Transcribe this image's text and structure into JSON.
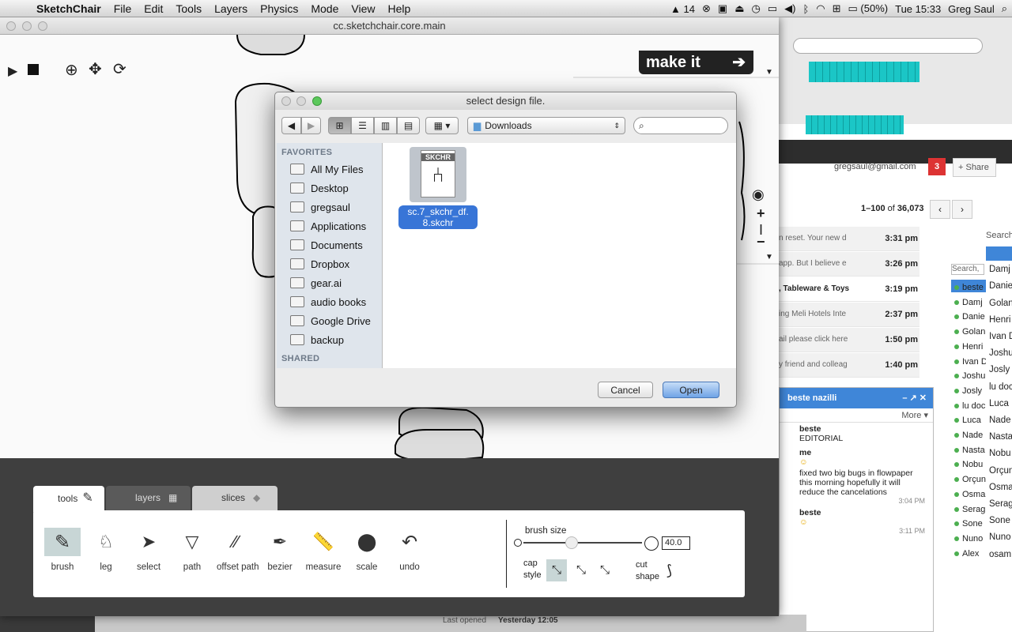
{
  "menubar": {
    "app_name": "SketchChair",
    "items": [
      "File",
      "Edit",
      "Tools",
      "Layers",
      "Physics",
      "Mode",
      "View",
      "Help"
    ],
    "status": {
      "notifications": "14",
      "battery": "(50%)",
      "clock": "Tue 15:33",
      "user": "Greg Saul"
    }
  },
  "app_window": {
    "title": "cc.sketchchair.core.main",
    "make_it_label": "make it",
    "tabs": [
      "tools",
      "layers",
      "slices"
    ],
    "tools": [
      "brush",
      "leg",
      "select",
      "path",
      "offset path",
      "bezier",
      "measure",
      "scale",
      "undo"
    ],
    "brush_size_label": "brush size",
    "brush_size_value": "40.0",
    "cap_style_label1": "cap",
    "cap_style_label2": "style",
    "cut_shape_label1": "cut",
    "cut_shape_label2": "shape"
  },
  "dialog": {
    "title": "select design file.",
    "location": "Downloads",
    "search_placeholder": "",
    "favorites_header": "FAVORITES",
    "favorites": [
      "All My Files",
      "Desktop",
      "gregsaul",
      "Applications",
      "Documents",
      "Dropbox",
      "gear.ai",
      "audio books",
      "Google Drive",
      "backup"
    ],
    "shared_header": "SHARED",
    "file": {
      "name_line1": "sc.7_skchr_df.",
      "name_line2": "8.skchr",
      "icon_label": "SKCHR"
    },
    "cancel_label": "Cancel",
    "open_label": "Open"
  },
  "background_mail": {
    "account": "gregsaul@gmail.com",
    "badge": "3",
    "share_label": "+ Share",
    "count_prefix": "1–100",
    "count_of": "of",
    "count_total": "36,073",
    "rows": [
      {
        "snippet": "n reset. Your new d",
        "time": "3:31 pm"
      },
      {
        "snippet": "app. But I believe e",
        "time": "3:26 pm"
      },
      {
        "snippet": ", Tableware & Toys",
        "time": "3:19 pm"
      },
      {
        "snippet": "ing Meli Hotels Inte",
        "time": "2:37 pm"
      },
      {
        "snippet": "ail please click here",
        "time": "1:50 pm"
      },
      {
        "snippet": "y friend and colleag",
        "time": "1:40 pm"
      }
    ],
    "chat": {
      "title": "beste nazilli",
      "more": "More ▾",
      "lines": [
        {
          "who": "beste",
          "text": "EDITORIAL"
        },
        {
          "who": "me",
          "text": "fixed two big bugs in flowpaper this morning hopefully it will reduce the cancelations",
          "time": "3:04 PM"
        },
        {
          "who": "beste",
          "text": "",
          "time": "3:11 PM"
        }
      ]
    },
    "contacts": [
      "beste",
      "Damj",
      "Danie",
      "Golan",
      "Henri",
      "Ivan D",
      "Joshu",
      "Josly",
      "lu doc",
      "Luca",
      "Nade",
      "Nasta",
      "Nobu",
      "Orçun",
      "Osma",
      "Serag",
      "Sone",
      "Nuno",
      "Alex"
    ],
    "contacts_wide": [
      "beste",
      "Damj",
      "Danie",
      "Golan",
      "Henri",
      "Ivan D",
      "Joshu",
      "Josly",
      "lu doc",
      "Luca",
      "Nade",
      "Nasta",
      "Nobu",
      "Orçun",
      "Osma",
      "Serag",
      "Sone",
      "Nuno",
      "osam"
    ],
    "search_label": "Search,",
    "last_opened": "Last opened",
    "yesterday": "Yesterday 12:05"
  }
}
